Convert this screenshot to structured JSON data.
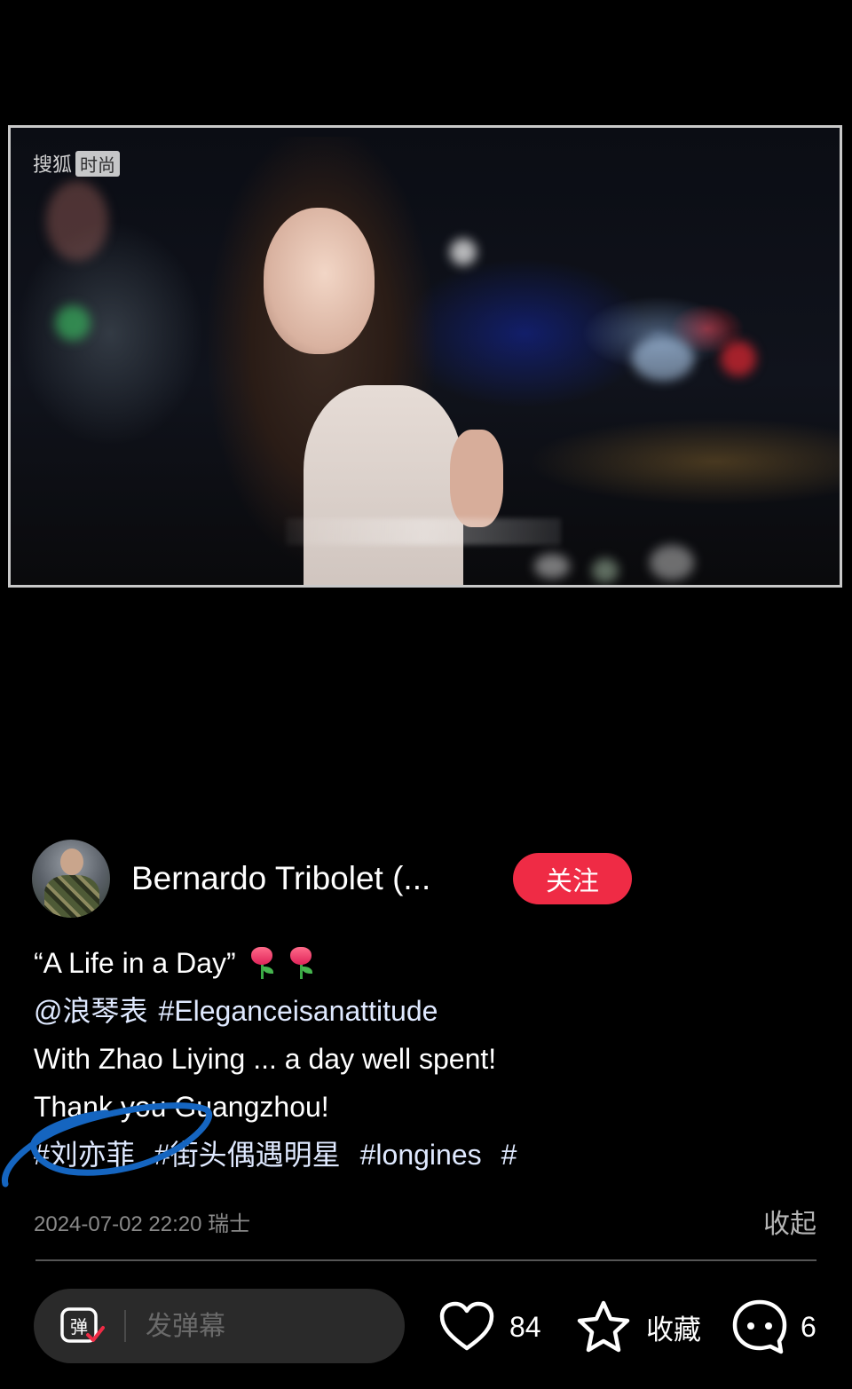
{
  "video": {
    "watermark_brand": "搜狐",
    "watermark_tag": "时尚"
  },
  "author": {
    "name": "Bernardo Tribolet (...",
    "follow_label": "关注"
  },
  "caption": {
    "line1_text": "“A Life in a Day”",
    "line2_mention": "@浪琴表",
    "line2_tag": "#Eleganceisanattitude",
    "line3_text": "With Zhao Liying ... a day well spent!",
    "line4_text": "Thank you Guangzhou!",
    "hashtags": [
      "#刘亦菲",
      "#街头偶遇明星",
      "#longines",
      "#"
    ]
  },
  "meta": {
    "timestamp": "2024-07-02 22:20 瑞士",
    "collapse_label": "收起"
  },
  "bottom_bar": {
    "danmu_placeholder": "发弹幕",
    "danmu_icon_glyph": "弹",
    "like_count": "84",
    "favorite_label": "收藏",
    "comment_count": "6"
  },
  "colors": {
    "background": "#000000",
    "follow_button": "#ef2b45",
    "annotation_stroke": "#1565c0",
    "danmu_check": "#ef2b45"
  },
  "icons": [
    "heart-icon",
    "star-icon",
    "comment-bubble-icon",
    "danmu-icon",
    "tulip-emoji"
  ]
}
